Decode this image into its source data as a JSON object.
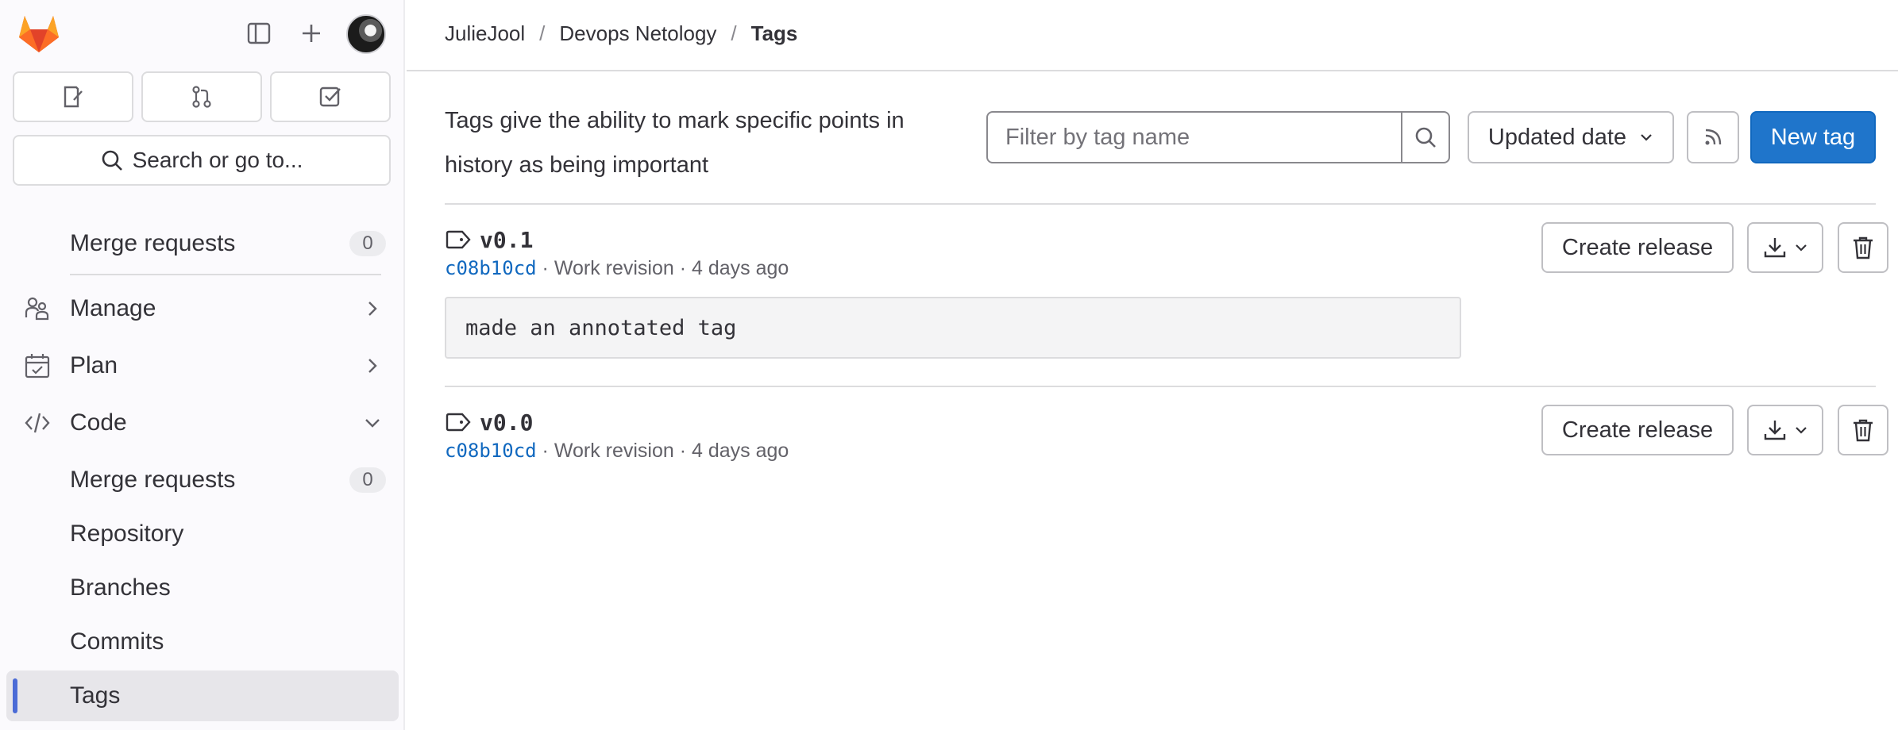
{
  "sidebar": {
    "search_label": "Search or go to...",
    "items": [
      {
        "label": "Merge requests",
        "badge": "0"
      },
      {
        "label": "Manage"
      },
      {
        "label": "Plan"
      },
      {
        "label": "Code"
      },
      {
        "label": "Merge requests",
        "badge": "0"
      },
      {
        "label": "Repository"
      },
      {
        "label": "Branches"
      },
      {
        "label": "Commits"
      },
      {
        "label": "Tags"
      }
    ]
  },
  "breadcrumb": {
    "items": [
      "JulieJool",
      "Devops Netology",
      "Tags"
    ],
    "separator": "/"
  },
  "page": {
    "description": "Tags give the ability to mark specific points in history as being important",
    "filter_placeholder": "Filter by tag name",
    "sort_label": "Updated date",
    "new_tag_label": "New tag"
  },
  "tags": [
    {
      "name": "v0.1",
      "sha": "c08b10cd",
      "meta": "· Work revision · 4 days ago",
      "message": "made an annotated tag",
      "release_label": "Create release"
    },
    {
      "name": "v0.0",
      "sha": "c08b10cd",
      "meta": "· Work revision · 4 days ago",
      "release_label": "Create release"
    }
  ],
  "colors": {
    "accent": "#1f75cb",
    "sha_link": "#1068bf",
    "active_indicator": "#4b6bd6"
  }
}
